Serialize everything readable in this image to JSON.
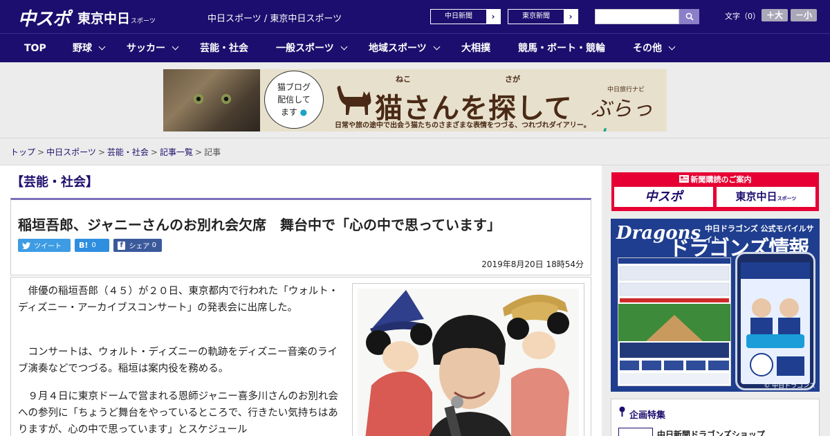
{
  "header": {
    "logo_primary": "中スポ",
    "logo_secondary": "東京中日",
    "logo_secondary_suffix": "スポーツ",
    "site_title": "中日スポーツ / 東京中日スポーツ",
    "link_chunichi": "中日新聞",
    "link_tokyo": "東京新聞",
    "search_placeholder": "",
    "font_label": "文字（0）",
    "font_bigger": "＋大",
    "font_smaller": "－小",
    "brand_color": "#1c0e6e"
  },
  "nav": {
    "items": [
      {
        "label": "TOP",
        "has_menu": false
      },
      {
        "label": "野球",
        "has_menu": true
      },
      {
        "label": "サッカー",
        "has_menu": true
      },
      {
        "label": "芸能・社会",
        "has_menu": false
      },
      {
        "label": "一般スポーツ",
        "has_menu": true
      },
      {
        "label": "地域スポーツ",
        "has_menu": true
      },
      {
        "label": "大相撲",
        "has_menu": false
      },
      {
        "label": "競馬・ボート・競輪",
        "has_menu": false
      },
      {
        "label": "その他",
        "has_menu": true
      }
    ]
  },
  "banner": {
    "speech": [
      "猫ブログ",
      "配信して",
      "ます"
    ],
    "title": "猫さんを探して",
    "ruby_neko": "ねこ",
    "ruby_saga": "さが",
    "subtitle": "日常や旅の途中で出会う猫たちのさまざまな表情をつづる、つれづれダイアリー。",
    "brand_small": "中日旅行ナビ",
    "brand_main": "ぶらっ",
    "brand_accent": "人"
  },
  "breadcrumb": {
    "items": [
      "トップ",
      "中日スポーツ",
      "芸能・社会",
      "記事一覧"
    ],
    "current": "記事",
    "separator": ">"
  },
  "article": {
    "category": "【芸能・社会】",
    "headline": "稲垣吾郎、ジャニーさんのお別れ会欠席　舞台中で「心の中で思っています」",
    "share_twitter": "ツイート",
    "share_hatena_icon": "B!",
    "share_hatena_count": "0",
    "share_facebook": "シェア",
    "share_facebook_count": "0",
    "date": "2019年8月20日 18時54分",
    "paragraphs": [
      "俳優の稲垣吾郎（４５）が２０日、東京都内で行われた「ウォルト・ディズニー・アーカイブスコンサート」の発表会に出席した。",
      "コンサートは、ウォルト・ディズニーの軌跡をディズニー音楽のライブ演奏などでつづる。稲垣は案内役を務める。",
      "９月４日に東京ドームで営まれる恩師ジャニー喜多川さんのお別れ会への参列に「ちょうど舞台をやっているところで、行きたい気持ちはありますが、心の中で思っています」とスケジュール"
    ]
  },
  "sidebar": {
    "subscribe_title": "新聞購読のご案内",
    "subscribe_logo1": "中スポ",
    "subscribe_logo2": "東京中日",
    "subscribe_logo2_suffix": "スポーツ",
    "dragons_script": "Dragons",
    "dragons_caption": "中日ドラゴンズ 公式モバイルサイト",
    "dragons_title": "ドラゴンズ情報",
    "dragons_footer": "© 中日ドラゴンズ",
    "feature_title": "企画特集",
    "feature_item": "中日新聞ドラゴンズショップ"
  }
}
